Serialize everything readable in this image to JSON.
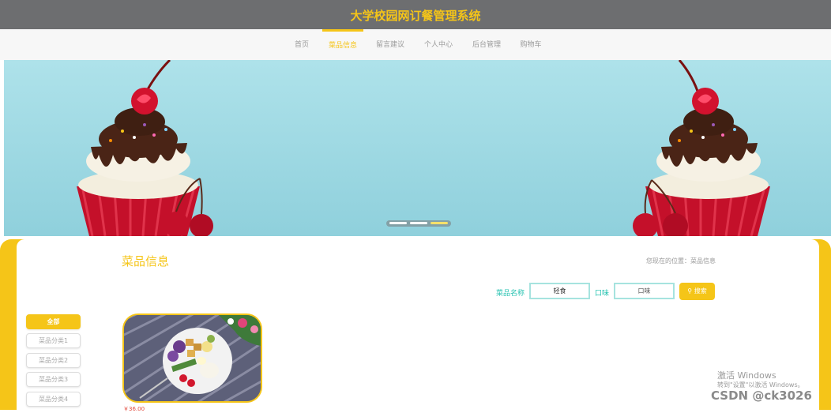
{
  "header": {
    "title": "大学校园网订餐管理系统"
  },
  "nav": {
    "items": [
      {
        "label": "首页"
      },
      {
        "label": "菜品信息"
      },
      {
        "label": "留言建议"
      },
      {
        "label": "个人中心"
      },
      {
        "label": "后台管理"
      },
      {
        "label": "购物车"
      }
    ],
    "active_index": 1
  },
  "banner": {
    "slides": 3,
    "active_slide": 2
  },
  "main": {
    "title": "菜品信息",
    "breadcrumb": "您现在的位置：菜品信息",
    "search": {
      "name_label": "菜品名称",
      "name_value": "轻食",
      "taste_label": "口味",
      "taste_placeholder": "口味",
      "button_label": "搜索"
    },
    "categories": [
      {
        "label": "全部"
      },
      {
        "label": "菜品分类1"
      },
      {
        "label": "菜品分类2"
      },
      {
        "label": "菜品分类3"
      },
      {
        "label": "菜品分类4"
      }
    ],
    "dishes": [
      {
        "price": "￥36.00"
      }
    ]
  },
  "watermark": {
    "line1": "激活 Windows",
    "line2": "转到\"设置\"以激活 Windows。",
    "csdn": "CSDN @ck3026"
  },
  "colors": {
    "accent": "#f5c518",
    "header_bg": "#6d6e70",
    "teal": "#25c2b0",
    "price": "#e2483b"
  }
}
